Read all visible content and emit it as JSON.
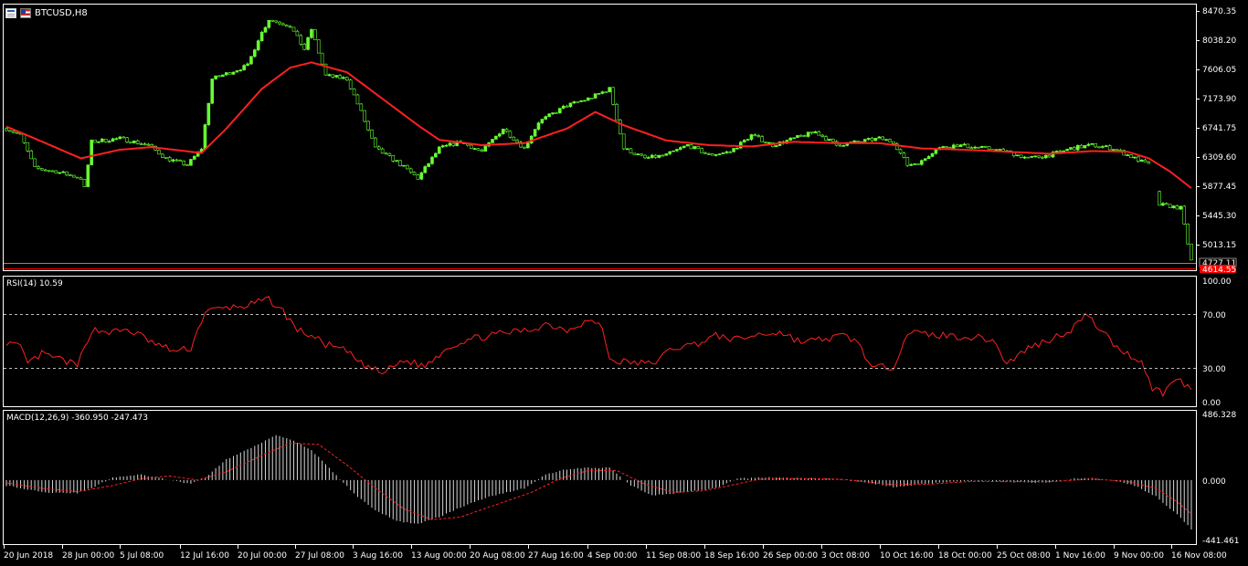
{
  "window": {
    "symbol": "BTCUSD,H8",
    "icons": [
      "table-icon",
      "flag-icon"
    ]
  },
  "colors": {
    "background": "#000000",
    "frame": "#ffffff",
    "bull_candle": "#66ff33",
    "bear_candle": "#000000",
    "ma": "#ff2020",
    "rsi": "#ff2020",
    "macd_hist": "#d8d8d8",
    "macd_signal": "#ff2020",
    "price_tag_bg": "#ff0000",
    "bid_line": "#888888"
  },
  "price_axis": {
    "labels": [
      "8470.35",
      "8038.20",
      "7606.05",
      "7173.90",
      "6741.75",
      "6309.60",
      "5877.45",
      "5445.30",
      "5013.15"
    ],
    "ask_tag": "4727.11",
    "bid_tag": "4614.55"
  },
  "rsi": {
    "label": "RSI(14) 10.59",
    "axis": [
      "100.00",
      "70.00",
      "30.00",
      "0.00"
    ],
    "levels": [
      70,
      30
    ]
  },
  "macd": {
    "label": "MACD(12,26,9) -360.950 -247.473",
    "axis": [
      "486.328",
      "0.000",
      "-441.461"
    ]
  },
  "time_axis": {
    "labels": [
      "20 Jun 2018",
      "28 Jun 00:00",
      "5 Jul 08:00",
      "12 Jul 16:00",
      "20 Jul 00:00",
      "27 Jul 08:00",
      "3 Aug 16:00",
      "13 Aug 00:00",
      "20 Aug 08:00",
      "27 Aug 16:00",
      "4 Sep 00:00",
      "11 Sep 08:00",
      "18 Sep 16:00",
      "26 Sep 00:00",
      "3 Oct 08:00",
      "10 Oct 16:00",
      "18 Oct 00:00",
      "25 Oct 08:00",
      "1 Nov 16:00",
      "9 Nov 00:00",
      "16 Nov 08:00"
    ]
  },
  "chart_data": {
    "type": "candlestick",
    "title": "BTCUSD,H8",
    "price_range": [
      4614.55,
      8470.35
    ],
    "price_keypoints": [
      [
        0,
        6700
      ],
      [
        4,
        6600
      ],
      [
        8,
        6100
      ],
      [
        14,
        6050
      ],
      [
        21,
        5950
      ],
      [
        22,
        5800
      ],
      [
        24,
        6500
      ],
      [
        32,
        6550
      ],
      [
        40,
        6450
      ],
      [
        45,
        6250
      ],
      [
        51,
        6150
      ],
      [
        55,
        6400
      ],
      [
        58,
        7450
      ],
      [
        68,
        7650
      ],
      [
        71,
        8050
      ],
      [
        74,
        8350
      ],
      [
        80,
        8250
      ],
      [
        84,
        7900
      ],
      [
        86,
        8200
      ],
      [
        90,
        7500
      ],
      [
        96,
        7450
      ],
      [
        100,
        6950
      ],
      [
        104,
        6400
      ],
      [
        110,
        6200
      ],
      [
        116,
        5950
      ],
      [
        122,
        6400
      ],
      [
        128,
        6500
      ],
      [
        134,
        6350
      ],
      [
        140,
        6700
      ],
      [
        146,
        6400
      ],
      [
        150,
        6800
      ],
      [
        158,
        7050
      ],
      [
        164,
        7150
      ],
      [
        170,
        7300
      ],
      [
        174,
        6400
      ],
      [
        180,
        6250
      ],
      [
        186,
        6300
      ],
      [
        192,
        6450
      ],
      [
        198,
        6300
      ],
      [
        204,
        6350
      ],
      [
        210,
        6600
      ],
      [
        216,
        6450
      ],
      [
        222,
        6550
      ],
      [
        228,
        6650
      ],
      [
        234,
        6450
      ],
      [
        240,
        6500
      ],
      [
        246,
        6550
      ],
      [
        250,
        6500
      ],
      [
        254,
        6150
      ],
      [
        258,
        6200
      ],
      [
        262,
        6400
      ],
      [
        268,
        6450
      ],
      [
        276,
        6400
      ],
      [
        282,
        6350
      ],
      [
        288,
        6250
      ],
      [
        294,
        6300
      ],
      [
        300,
        6400
      ],
      [
        306,
        6450
      ],
      [
        312,
        6400
      ],
      [
        318,
        6250
      ],
      [
        322,
        6150
      ],
      [
        325,
        5550
      ],
      [
        331,
        5500
      ],
      [
        334,
        4700
      ]
    ],
    "ma_keypoints": [
      [
        0,
        6730
      ],
      [
        8,
        6550
      ],
      [
        21,
        6250
      ],
      [
        32,
        6380
      ],
      [
        41,
        6420
      ],
      [
        55,
        6330
      ],
      [
        62,
        6700
      ],
      [
        72,
        7300
      ],
      [
        80,
        7620
      ],
      [
        86,
        7700
      ],
      [
        96,
        7550
      ],
      [
        106,
        7150
      ],
      [
        116,
        6750
      ],
      [
        122,
        6530
      ],
      [
        134,
        6450
      ],
      [
        146,
        6480
      ],
      [
        158,
        6700
      ],
      [
        166,
        6950
      ],
      [
        174,
        6750
      ],
      [
        186,
        6520
      ],
      [
        198,
        6450
      ],
      [
        210,
        6430
      ],
      [
        222,
        6500
      ],
      [
        234,
        6480
      ],
      [
        246,
        6480
      ],
      [
        258,
        6400
      ],
      [
        270,
        6380
      ],
      [
        282,
        6350
      ],
      [
        294,
        6320
      ],
      [
        306,
        6360
      ],
      [
        316,
        6350
      ],
      [
        322,
        6250
      ],
      [
        328,
        6050
      ],
      [
        334,
        5800
      ]
    ],
    "rsi_keypoints": [
      [
        0,
        50
      ],
      [
        4,
        45
      ],
      [
        6,
        32
      ],
      [
        10,
        40
      ],
      [
        16,
        35
      ],
      [
        20,
        30
      ],
      [
        24,
        60
      ],
      [
        30,
        58
      ],
      [
        34,
        60
      ],
      [
        38,
        55
      ],
      [
        42,
        48
      ],
      [
        48,
        42
      ],
      [
        52,
        45
      ],
      [
        56,
        75
      ],
      [
        62,
        78
      ],
      [
        68,
        80
      ],
      [
        74,
        85
      ],
      [
        78,
        75
      ],
      [
        82,
        60
      ],
      [
        86,
        55
      ],
      [
        90,
        48
      ],
      [
        96,
        42
      ],
      [
        100,
        32
      ],
      [
        106,
        24
      ],
      [
        112,
        35
      ],
      [
        118,
        30
      ],
      [
        124,
        45
      ],
      [
        130,
        52
      ],
      [
        136,
        55
      ],
      [
        142,
        58
      ],
      [
        148,
        60
      ],
      [
        152,
        65
      ],
      [
        158,
        60
      ],
      [
        164,
        68
      ],
      [
        168,
        62
      ],
      [
        170,
        35
      ],
      [
        176,
        33
      ],
      [
        182,
        32
      ],
      [
        188,
        45
      ],
      [
        194,
        48
      ],
      [
        200,
        55
      ],
      [
        206,
        52
      ],
      [
        212,
        56
      ],
      [
        218,
        58
      ],
      [
        224,
        50
      ],
      [
        230,
        52
      ],
      [
        236,
        55
      ],
      [
        240,
        50
      ],
      [
        244,
        28
      ],
      [
        250,
        30
      ],
      [
        254,
        58
      ],
      [
        260,
        56
      ],
      [
        266,
        55
      ],
      [
        272,
        54
      ],
      [
        278,
        52
      ],
      [
        282,
        32
      ],
      [
        288,
        45
      ],
      [
        294,
        52
      ],
      [
        300,
        60
      ],
      [
        304,
        72
      ],
      [
        308,
        62
      ],
      [
        312,
        48
      ],
      [
        316,
        40
      ],
      [
        320,
        34
      ],
      [
        323,
        12
      ],
      [
        326,
        8
      ],
      [
        330,
        20
      ],
      [
        334,
        10.59
      ]
    ],
    "macd_keypoints": [
      [
        0,
        -40
      ],
      [
        6,
        -70
      ],
      [
        12,
        -90
      ],
      [
        20,
        -95
      ],
      [
        24,
        -60
      ],
      [
        30,
        20
      ],
      [
        38,
        40
      ],
      [
        44,
        10
      ],
      [
        52,
        -30
      ],
      [
        56,
        20
      ],
      [
        62,
        150
      ],
      [
        70,
        250
      ],
      [
        76,
        330
      ],
      [
        80,
        300
      ],
      [
        86,
        220
      ],
      [
        92,
        60
      ],
      [
        98,
        -100
      ],
      [
        104,
        -220
      ],
      [
        110,
        -300
      ],
      [
        116,
        -320
      ],
      [
        122,
        -270
      ],
      [
        128,
        -200
      ],
      [
        136,
        -120
      ],
      [
        146,
        -60
      ],
      [
        152,
        40
      ],
      [
        158,
        80
      ],
      [
        164,
        90
      ],
      [
        170,
        90
      ],
      [
        176,
        -40
      ],
      [
        182,
        -110
      ],
      [
        188,
        -100
      ],
      [
        194,
        -80
      ],
      [
        200,
        -60
      ],
      [
        206,
        10
      ],
      [
        214,
        20
      ],
      [
        222,
        15
      ],
      [
        232,
        10
      ],
      [
        238,
        -5
      ],
      [
        244,
        -25
      ],
      [
        250,
        -50
      ],
      [
        258,
        -30
      ],
      [
        266,
        -10
      ],
      [
        276,
        -5
      ],
      [
        284,
        -15
      ],
      [
        294,
        -20
      ],
      [
        300,
        10
      ],
      [
        306,
        15
      ],
      [
        312,
        0
      ],
      [
        318,
        -40
      ],
      [
        324,
        -120
      ],
      [
        330,
        -250
      ],
      [
        334,
        -360.95
      ]
    ],
    "macd_signal_keypoints": [
      [
        0,
        -20
      ],
      [
        10,
        -60
      ],
      [
        20,
        -85
      ],
      [
        30,
        -40
      ],
      [
        38,
        10
      ],
      [
        46,
        30
      ],
      [
        54,
        0
      ],
      [
        62,
        60
      ],
      [
        72,
        180
      ],
      [
        80,
        270
      ],
      [
        88,
        260
      ],
      [
        96,
        110
      ],
      [
        104,
        -60
      ],
      [
        112,
        -210
      ],
      [
        120,
        -290
      ],
      [
        128,
        -270
      ],
      [
        138,
        -180
      ],
      [
        148,
        -90
      ],
      [
        156,
        10
      ],
      [
        164,
        70
      ],
      [
        172,
        70
      ],
      [
        180,
        -30
      ],
      [
        188,
        -90
      ],
      [
        196,
        -80
      ],
      [
        204,
        -40
      ],
      [
        212,
        5
      ],
      [
        224,
        12
      ],
      [
        236,
        5
      ],
      [
        248,
        -30
      ],
      [
        260,
        -30
      ],
      [
        272,
        -10
      ],
      [
        284,
        -12
      ],
      [
        296,
        -10
      ],
      [
        306,
        8
      ],
      [
        316,
        -10
      ],
      [
        324,
        -60
      ],
      [
        330,
        -160
      ],
      [
        334,
        -247.473
      ]
    ],
    "rsi_range": [
      0,
      100
    ],
    "macd_range": [
      -441.461,
      486.328
    ]
  }
}
